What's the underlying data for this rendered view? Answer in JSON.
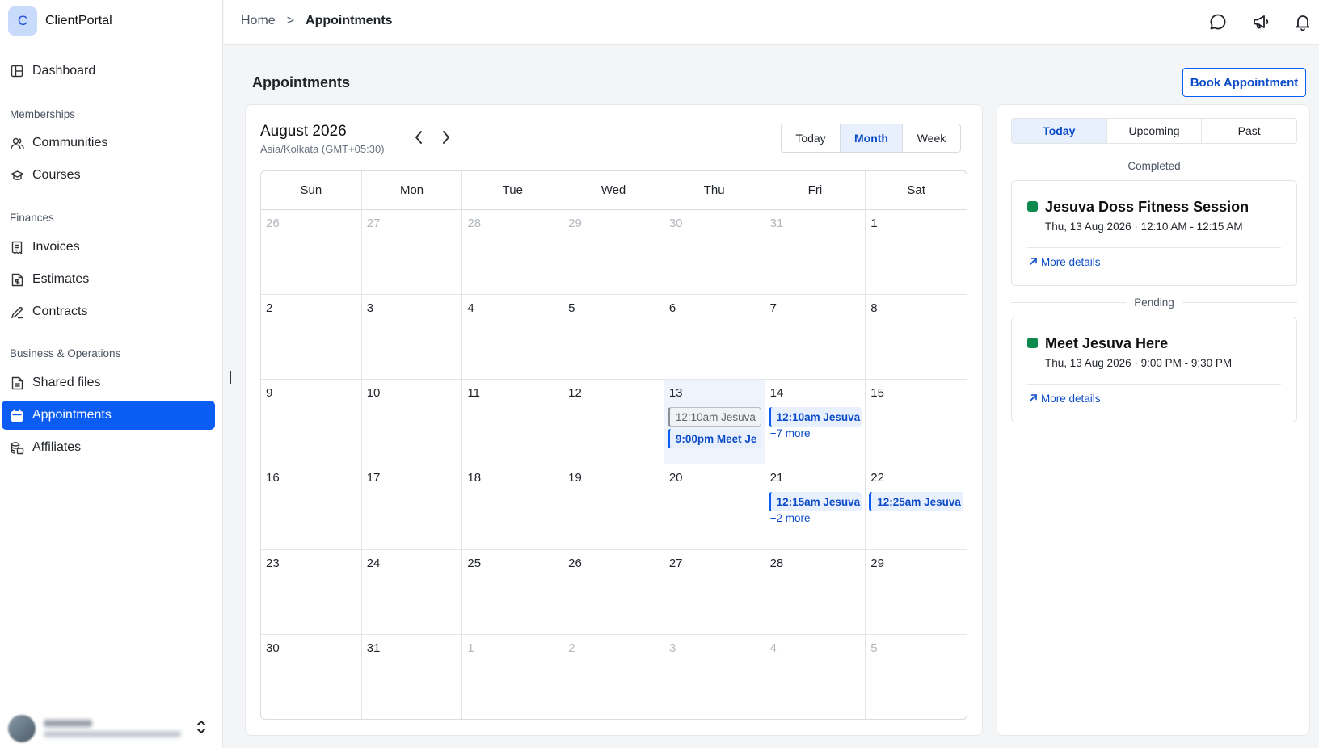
{
  "brand": {
    "initial": "C",
    "name": "ClientPortal"
  },
  "nav": {
    "dashboard": "Dashboard",
    "memberships_header": "Memberships",
    "communities": "Communities",
    "courses": "Courses",
    "finances_header": "Finances",
    "invoices": "Invoices",
    "estimates": "Estimates",
    "contracts": "Contracts",
    "business_header": "Business & Operations",
    "shared_files": "Shared files",
    "appointments": "Appointments",
    "affiliates": "Affiliates"
  },
  "breadcrumb": {
    "home": "Home",
    "separator": ">",
    "current": "Appointments"
  },
  "page": {
    "title": "Appointments",
    "book_button": "Book Appointment"
  },
  "calendar": {
    "month_label": "August 2026",
    "timezone": "Asia/Kolkata (GMT+05:30)",
    "views": [
      "Today",
      "Month",
      "Week"
    ],
    "active_view": "Month",
    "weekdays": [
      "Sun",
      "Mon",
      "Tue",
      "Wed",
      "Thu",
      "Fri",
      "Sat"
    ],
    "days": [
      {
        "n": "26",
        "muted": true
      },
      {
        "n": "27",
        "muted": true
      },
      {
        "n": "28",
        "muted": true
      },
      {
        "n": "29",
        "muted": true
      },
      {
        "n": "30",
        "muted": true
      },
      {
        "n": "31",
        "muted": true
      },
      {
        "n": "1"
      },
      {
        "n": "2"
      },
      {
        "n": "3"
      },
      {
        "n": "4"
      },
      {
        "n": "5"
      },
      {
        "n": "6"
      },
      {
        "n": "7"
      },
      {
        "n": "8"
      },
      {
        "n": "9"
      },
      {
        "n": "10"
      },
      {
        "n": "11"
      },
      {
        "n": "12"
      },
      {
        "n": "13",
        "today": true,
        "events": [
          {
            "label": "12:10am Jesuva",
            "done": true
          },
          {
            "label": "9:00pm Meet Je"
          }
        ]
      },
      {
        "n": "14",
        "events": [
          {
            "label": "12:10am Jesuva"
          }
        ],
        "more": "+7 more"
      },
      {
        "n": "15"
      },
      {
        "n": "16"
      },
      {
        "n": "17"
      },
      {
        "n": "18"
      },
      {
        "n": "19"
      },
      {
        "n": "20"
      },
      {
        "n": "21",
        "events": [
          {
            "label": "12:15am Jesuva"
          }
        ],
        "more": "+2 more"
      },
      {
        "n": "22",
        "events": [
          {
            "label": "12:25am Jesuva"
          }
        ]
      },
      {
        "n": "23"
      },
      {
        "n": "24"
      },
      {
        "n": "25"
      },
      {
        "n": "26"
      },
      {
        "n": "27"
      },
      {
        "n": "28"
      },
      {
        "n": "29"
      },
      {
        "n": "30"
      },
      {
        "n": "31"
      },
      {
        "n": "1",
        "muted": true
      },
      {
        "n": "2",
        "muted": true
      },
      {
        "n": "3",
        "muted": true
      },
      {
        "n": "4",
        "muted": true
      },
      {
        "n": "5",
        "muted": true
      }
    ]
  },
  "side_panel": {
    "tabs": [
      "Today",
      "Upcoming",
      "Past"
    ],
    "active_tab": "Today",
    "groups": [
      {
        "heading": "Completed",
        "appointment": {
          "title": "Jesuva Doss Fitness Session",
          "time": "Thu, 13 Aug 2026 · 12:10 AM - 12:15 AM",
          "link": "More details",
          "status_color": "#0e8a4f"
        }
      },
      {
        "heading": "Pending",
        "appointment": {
          "title": "Meet Jesuva Here",
          "time": "Thu, 13 Aug 2026 · 9:00 PM - 9:30 PM",
          "link": "More details",
          "status_color": "#0e8a4f"
        }
      }
    ]
  },
  "colors": {
    "accent": "#0b5cf2",
    "status_green": "#0e8a4f"
  },
  "icons": {
    "dashboard": "layout-grid-icon",
    "communities": "users-icon",
    "courses": "graduation-cap-icon",
    "invoices": "receipt-icon",
    "estimates": "file-dollar-icon",
    "contracts": "pen-signature-icon",
    "shared_files": "file-text-icon",
    "appointments": "calendar-icon",
    "affiliates": "stack-coins-icon",
    "chat": "chat-bubble-icon",
    "announce": "megaphone-icon",
    "bell": "bell-icon"
  }
}
